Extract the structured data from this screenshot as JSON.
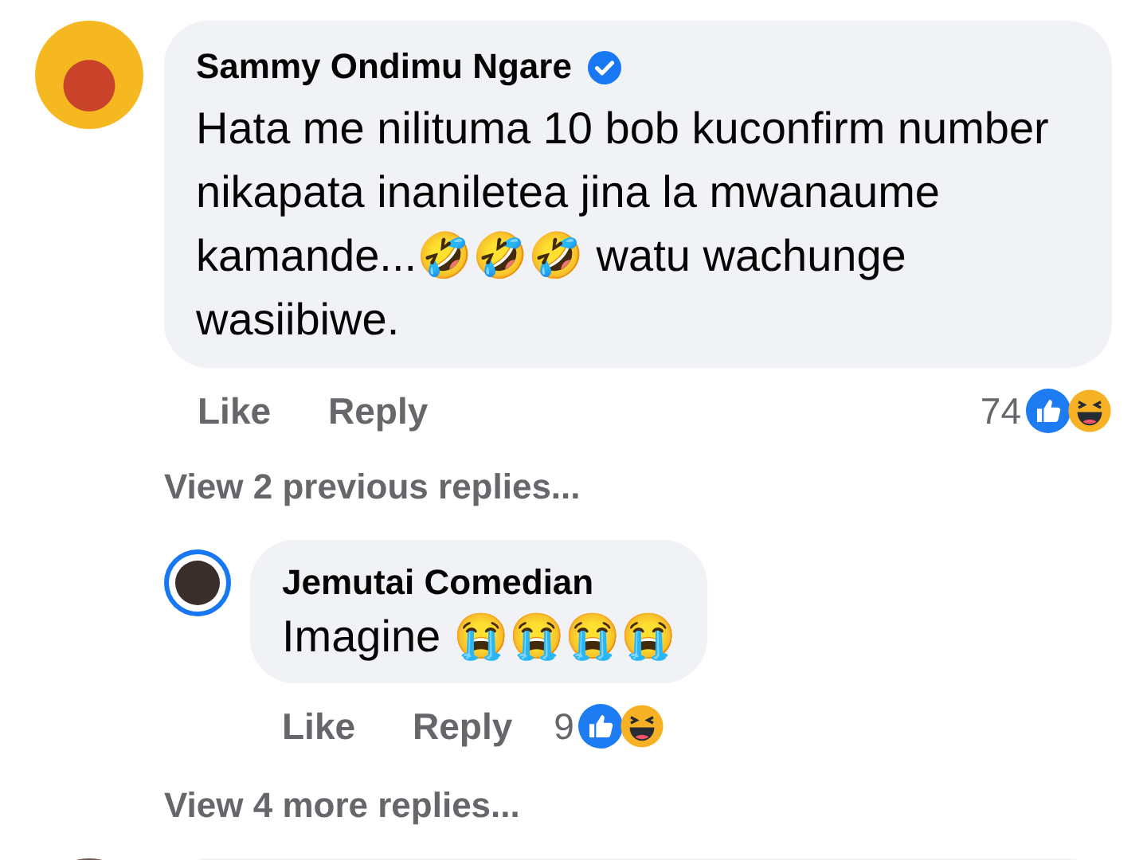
{
  "comment": {
    "author": "Sammy Ondimu Ngare",
    "verified": true,
    "text": "Hata me nilituma 10 bob kuconfirm number nikapata inaniletea jina la mwanaume kamande...🤣🤣🤣 watu wachunge wasiibiwe.",
    "actions": [
      "Like",
      "Reply"
    ],
    "reaction_count": "74"
  },
  "view_previous": "View 2 previous replies...",
  "reply": {
    "author": "Jemutai Comedian",
    "has_story": true,
    "text": "Imagine 😭😭😭😭",
    "actions": [
      "Like",
      "Reply"
    ],
    "reaction_count": "9"
  },
  "view_more": "View 4 more replies..."
}
